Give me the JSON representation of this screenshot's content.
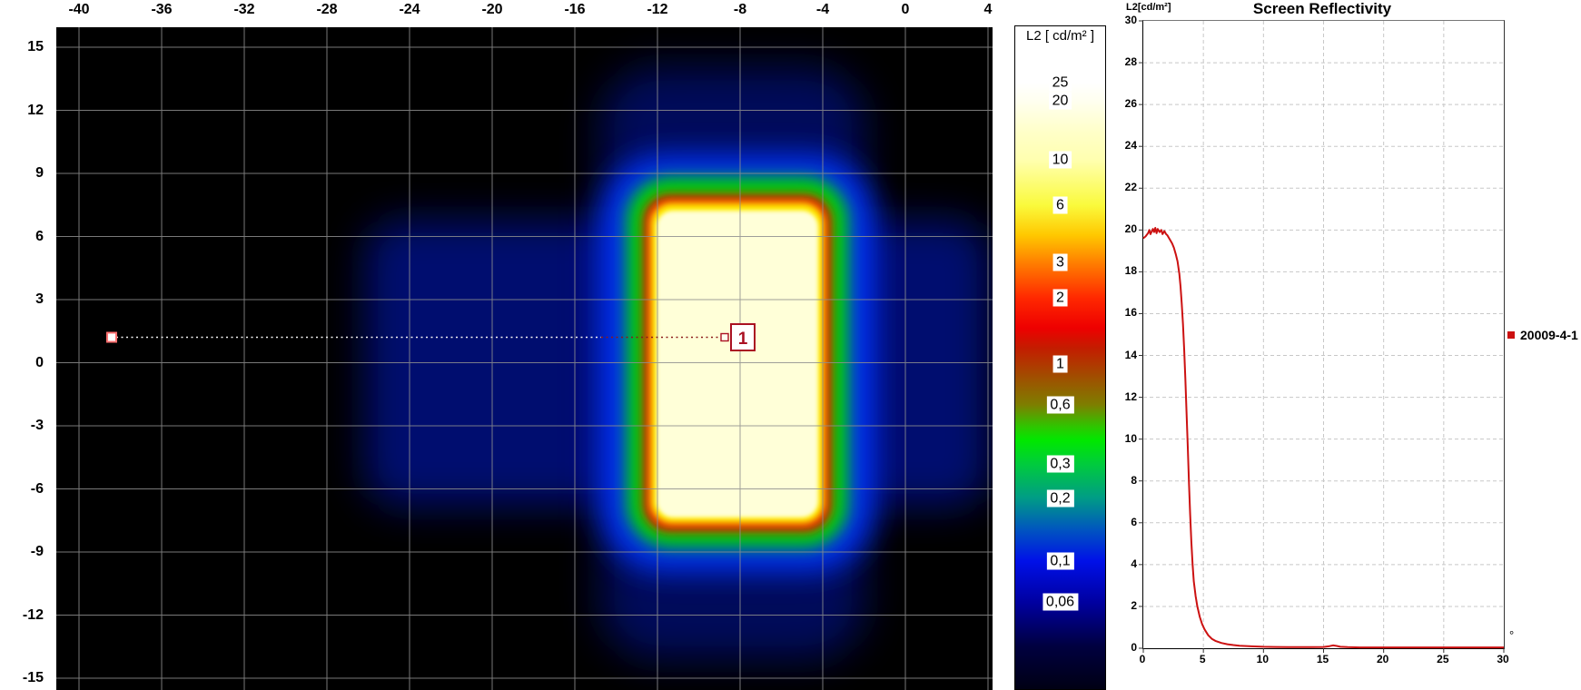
{
  "heatmap": {
    "x_tick_labels": [
      "-40",
      "-36",
      "-32",
      "-28",
      "-24",
      "-20",
      "-16",
      "-12",
      "-8",
      "-4",
      "0",
      "4"
    ],
    "y_tick_labels": [
      "15",
      "12",
      "9",
      "6",
      "3",
      "0",
      "-3",
      "-6",
      "-9",
      "-12",
      "-15"
    ],
    "marker_label": "1"
  },
  "colorbar": {
    "title": "L2 [ cd/m² ]",
    "labels": [
      "25",
      "20",
      "10",
      "6",
      "3",
      "2",
      "1",
      "0,6",
      "0,3",
      "0,2",
      "0,1",
      "0,06"
    ]
  },
  "reflectivity_chart": {
    "title": "Screen Reflectivity",
    "y_axis_label": "L2[cd/m²]",
    "x_axis_unit": "°",
    "legend_label": "20009-4-1",
    "legend_color": "#cc1111",
    "y_tick_labels": [
      "30",
      "28",
      "26",
      "24",
      "22",
      "20",
      "18",
      "16",
      "14",
      "12",
      "10",
      "8",
      "6",
      "4",
      "2",
      "0"
    ],
    "x_tick_labels": [
      "0",
      "5",
      "10",
      "15",
      "20",
      "25",
      "30"
    ]
  },
  "chart_data": [
    {
      "type": "heatmap",
      "title": "",
      "colorbar_title": "L2 [ cd/m² ]",
      "colorbar_scale_values": [
        25,
        20,
        10,
        6,
        3,
        2,
        1,
        0.6,
        0.3,
        0.2,
        0.1,
        0.06
      ],
      "scale": "logarithmic",
      "x_ticks": [
        -40,
        -36,
        -32,
        -28,
        -24,
        -20,
        -16,
        -12,
        -8,
        -4,
        0,
        4
      ],
      "y_ticks": [
        15,
        12,
        9,
        6,
        3,
        0,
        -3,
        -6,
        -9,
        -12,
        -15
      ],
      "x_range": [
        -41.1,
        4.2
      ],
      "y_range": [
        -15.7,
        15.9
      ],
      "grid": true,
      "bright_region": {
        "x_extent": [
          -12.5,
          -4.2
        ],
        "y_extent": [
          -7.9,
          7.8
        ],
        "peak_value_cd_m2": 20
      },
      "marker": {
        "label": "1",
        "x_deg": -8,
        "y_deg": 1.2,
        "line_start_x_deg": -38.5
      }
    },
    {
      "type": "line",
      "title": "Screen Reflectivity",
      "ylabel": "L2[cd/m²]",
      "xlabel": "°",
      "xlim": [
        0,
        30
      ],
      "ylim": [
        0,
        30
      ],
      "x_ticks": [
        0,
        5,
        10,
        15,
        20,
        25,
        30
      ],
      "y_ticks": [
        0,
        2,
        4,
        6,
        8,
        10,
        12,
        14,
        16,
        18,
        20,
        22,
        24,
        26,
        28,
        30
      ],
      "grid": "dashed",
      "legend_position": "right",
      "series": [
        {
          "name": "20009-4-1",
          "color": "#cc1111",
          "x": [
            0,
            0.2,
            0.4,
            0.5,
            0.6,
            0.8,
            0.9,
            1.0,
            1.1,
            1.2,
            1.35,
            1.5,
            1.6,
            1.75,
            1.9,
            2.0,
            2.1,
            2.25,
            2.4,
            2.55,
            2.7,
            2.85,
            3.0,
            3.1,
            3.2,
            3.3,
            3.4,
            3.5,
            3.6,
            3.7,
            3.8,
            3.9,
            4.0,
            4.1,
            4.2,
            4.35,
            4.5,
            4.7,
            4.9,
            5.1,
            5.4,
            5.7,
            6.0,
            6.5,
            7.0,
            7.5,
            8.0,
            9.0,
            10.0,
            11,
            12,
            13,
            14,
            15,
            15.5,
            15.8,
            16.1,
            16.4,
            17,
            18,
            20,
            22,
            24,
            26,
            28,
            30
          ],
          "y": [
            19.6,
            19.7,
            19.85,
            20.0,
            19.8,
            20.05,
            19.9,
            20.1,
            19.85,
            20.05,
            19.9,
            20.0,
            19.8,
            19.95,
            19.8,
            19.75,
            19.65,
            19.5,
            19.35,
            19.15,
            18.85,
            18.5,
            17.9,
            17.3,
            16.5,
            15.5,
            14.3,
            12.9,
            11.3,
            9.6,
            7.9,
            6.4,
            5.1,
            4.0,
            3.2,
            2.5,
            2.0,
            1.5,
            1.15,
            0.9,
            0.62,
            0.45,
            0.35,
            0.25,
            0.19,
            0.15,
            0.12,
            0.09,
            0.07,
            0.06,
            0.05,
            0.05,
            0.05,
            0.06,
            0.1,
            0.14,
            0.11,
            0.07,
            0.05,
            0.04,
            0.04,
            0.04,
            0.04,
            0.04,
            0.04,
            0.04
          ]
        }
      ]
    }
  ]
}
